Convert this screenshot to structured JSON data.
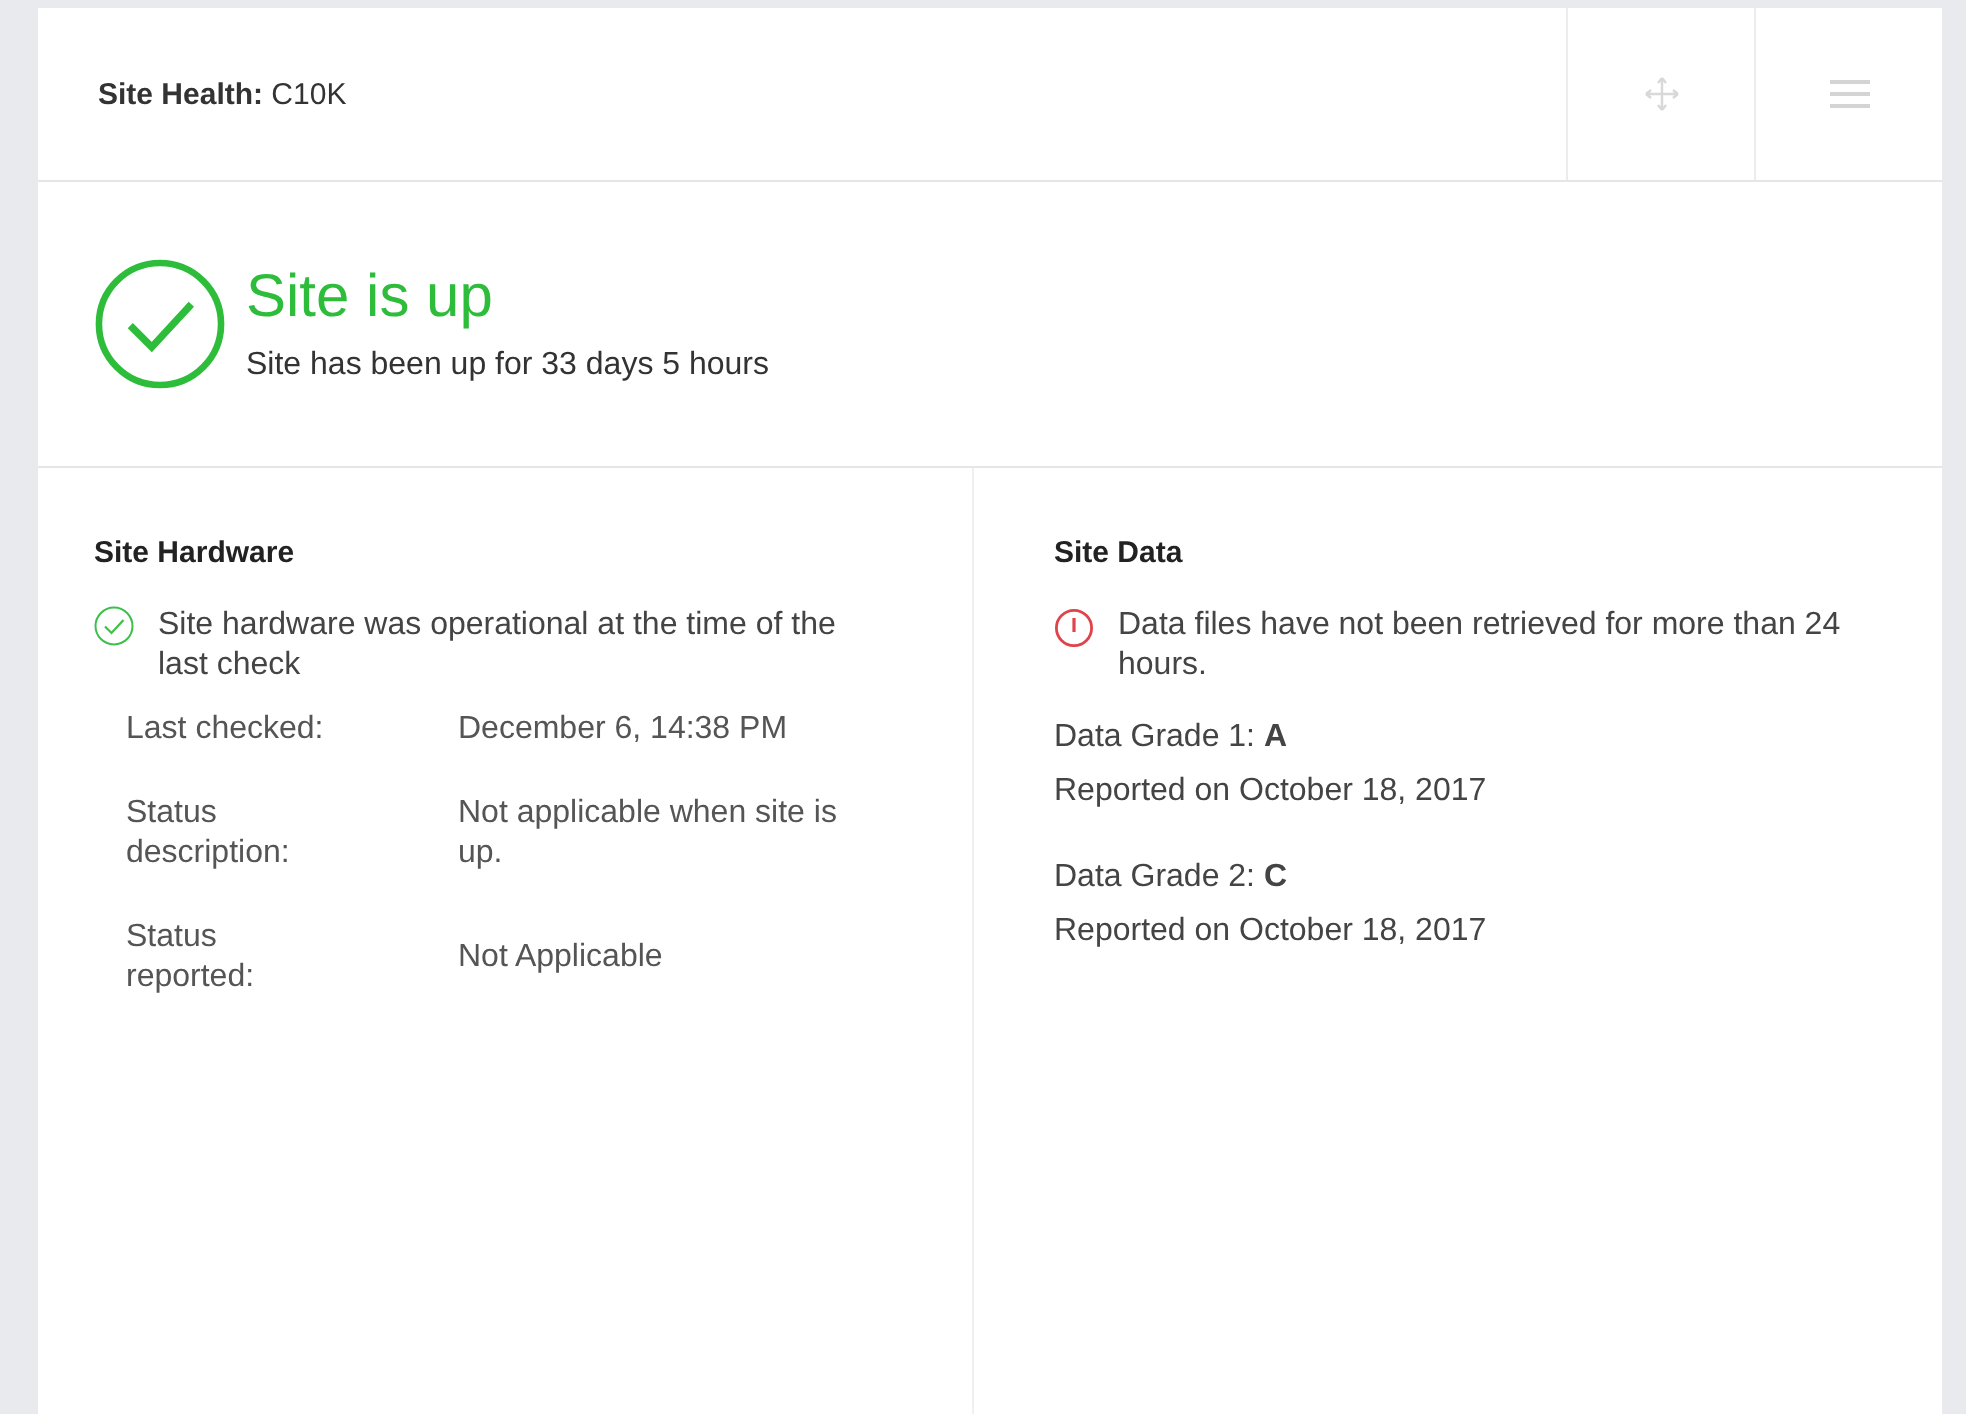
{
  "header": {
    "title": "**Site Health:** C10K"
  },
  "status": {
    "kind": "up",
    "headline": "Site is up",
    "detail": "Site has been up for 33 days 5 hours"
  },
  "hardware": {
    "title": "Site Hardware",
    "notice": {
      "kind": "ok",
      "text": "Site hardware was operational at the time of the last check"
    },
    "details": [
      {
        "label": "Last checked:",
        "value": "December 6, 14:38 PM"
      },
      {
        "label": "Status description:",
        "value": "Not applicable when site is up."
      },
      {
        "label": "Status reported:",
        "value": "Not Applicable"
      }
    ]
  },
  "data": {
    "title": "Site Data",
    "notice": {
      "kind": "warning",
      "text": "Data files have not been retrieved for more than 24 hours."
    },
    "grades": [
      {
        "grade": "Data Grade 1: **A**",
        "reported": "Reported on October 18, 2017"
      },
      {
        "grade": "Data Grade 2: **C**",
        "reported": "Reported on October 18, 2017"
      }
    ]
  }
}
